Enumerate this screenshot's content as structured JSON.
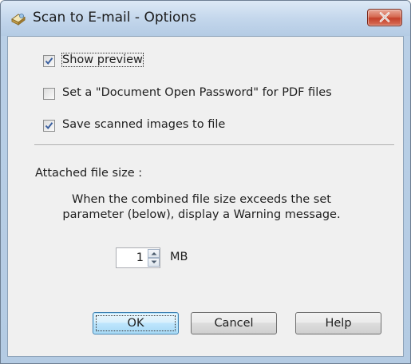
{
  "window": {
    "title": "Scan to E-mail - Options"
  },
  "options": {
    "show_preview": {
      "label": "Show preview",
      "checked": true
    },
    "pdf_password": {
      "label": "Set a \"Document Open Password\" for PDF files",
      "checked": false
    },
    "save_to_file": {
      "label": "Save scanned images to file",
      "checked": true
    }
  },
  "file_size": {
    "heading": "Attached file size :",
    "message_line1": "When the combined file size exceeds the set",
    "message_line2": "parameter (below), display a Warning message.",
    "value": "1",
    "unit": "MB"
  },
  "buttons": {
    "ok": "OK",
    "cancel": "Cancel",
    "help": "Help"
  },
  "colors": {
    "titlebar": "#c4d7ec",
    "close_button": "#c5412a",
    "client_background": "#f0f0f0",
    "default_button": "#bee6fd"
  },
  "icons": {
    "title": "scanner-mail-icon",
    "close": "close-icon",
    "check": "checkmark-icon",
    "spin_up": "spin-up-arrow-icon",
    "spin_down": "spin-down-arrow-icon"
  }
}
